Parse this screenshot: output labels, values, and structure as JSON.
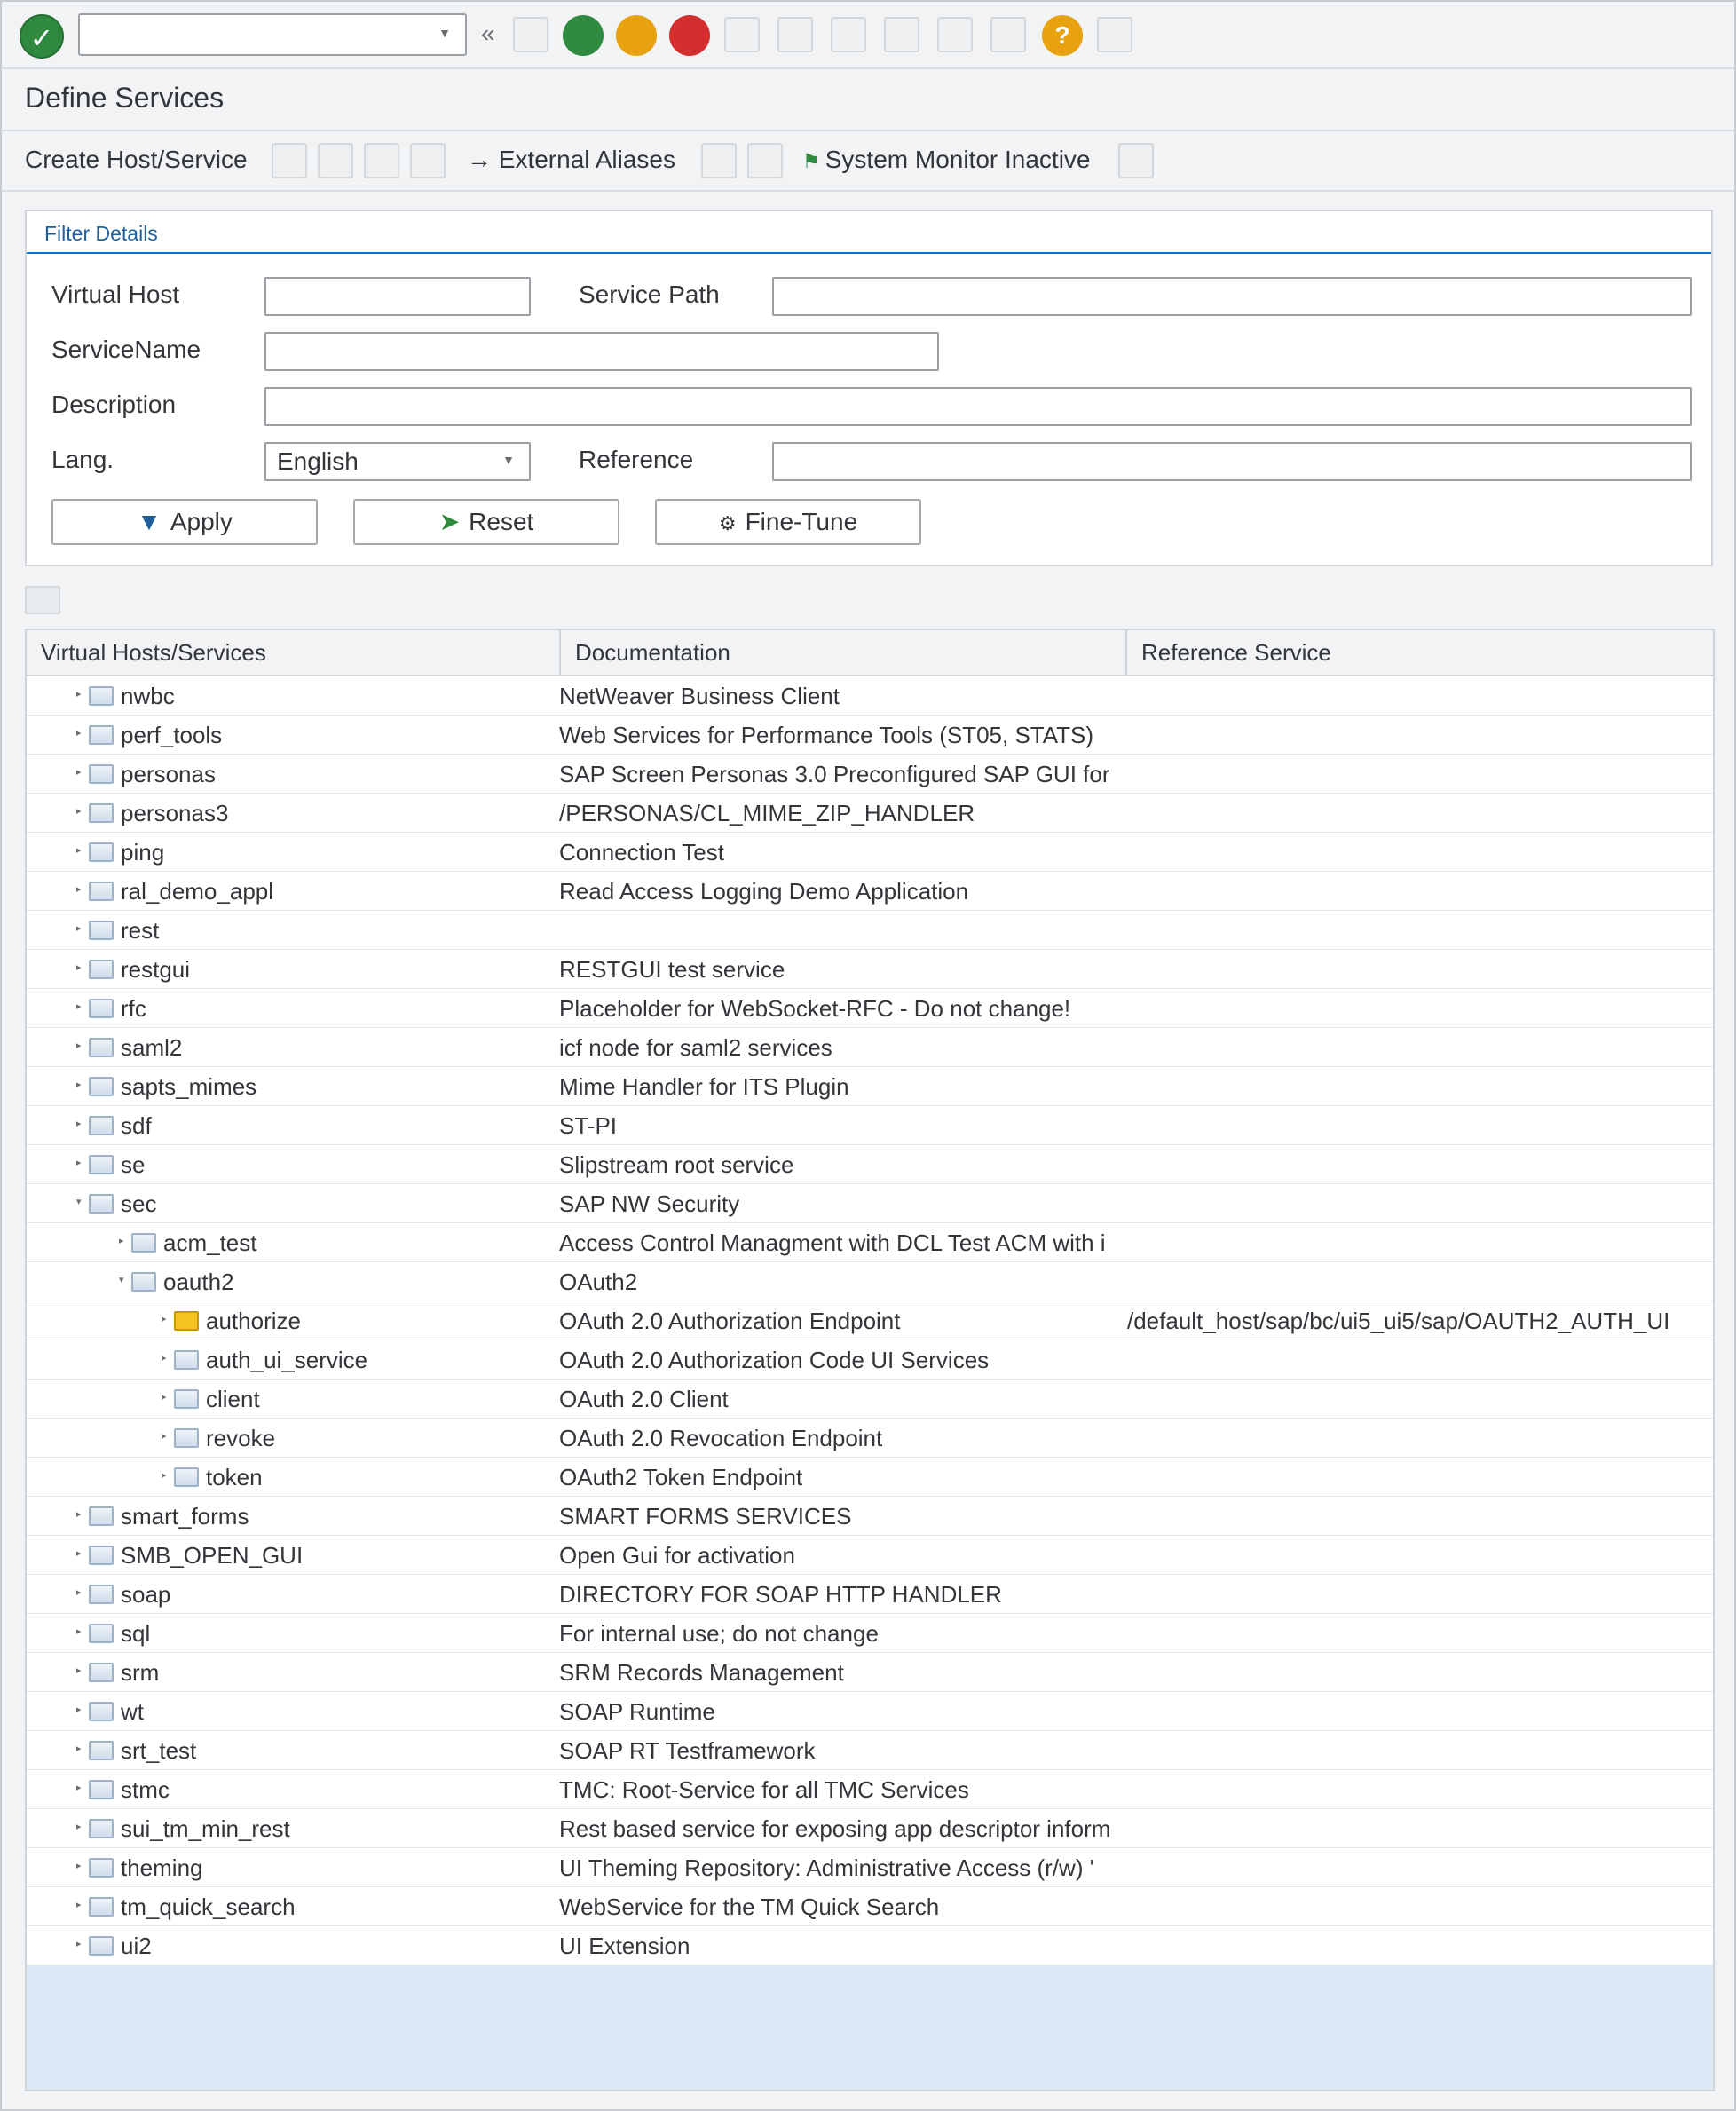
{
  "toolbar": {
    "command_field_value": "",
    "collapse_glyph": "«",
    "ok_glyph": "✓",
    "help_glyph": "?",
    "colors": {
      "green": "#2f8a3f",
      "orange": "#e8a20f",
      "red": "#d32f2f"
    }
  },
  "page": {
    "title": "Define Services"
  },
  "app_toolbar": {
    "create_host_service": "Create Host/Service",
    "external_aliases": "External Aliases",
    "external_aliases_icon": "→",
    "system_monitor": "System Monitor Inactive",
    "system_monitor_icon": "flag-icon"
  },
  "filter": {
    "header": "Filter Details",
    "virtual_host_label": "Virtual Host",
    "virtual_host_value": "",
    "service_path_label": "Service Path",
    "service_path_value": "",
    "service_name_label": "ServiceName",
    "service_name_value": "",
    "description_label": "Description",
    "description_value": "",
    "lang_label": "Lang.",
    "lang_value": "English",
    "reference_label": "Reference",
    "reference_value": "",
    "apply_label": "Apply",
    "reset_label": "Reset",
    "finetune_label": "Fine-Tune"
  },
  "table": {
    "columns": [
      "Virtual Hosts/Services",
      "Documentation",
      "Reference Service"
    ],
    "rows": [
      {
        "level": 0,
        "expanded": false,
        "name": "nwbc",
        "doc": "NetWeaver Business Client",
        "ref": ""
      },
      {
        "level": 0,
        "expanded": false,
        "name": "perf_tools",
        "doc": "Web Services for Performance Tools (ST05, STATS)",
        "ref": ""
      },
      {
        "level": 0,
        "expanded": false,
        "name": "personas",
        "doc": "SAP Screen Personas 3.0 Preconfigured SAP GUI for",
        "ref": ""
      },
      {
        "level": 0,
        "expanded": false,
        "name": "personas3",
        "doc": "/PERSONAS/CL_MIME_ZIP_HANDLER",
        "ref": ""
      },
      {
        "level": 0,
        "expanded": false,
        "name": "ping",
        "doc": "Connection Test",
        "ref": ""
      },
      {
        "level": 0,
        "expanded": false,
        "name": "ral_demo_appl",
        "doc": "Read Access Logging Demo Application",
        "ref": ""
      },
      {
        "level": 0,
        "expanded": false,
        "name": "rest",
        "doc": "",
        "ref": ""
      },
      {
        "level": 0,
        "expanded": false,
        "name": "restgui",
        "doc": "RESTGUI test service",
        "ref": ""
      },
      {
        "level": 0,
        "expanded": false,
        "name": "rfc",
        "doc": "Placeholder for WebSocket-RFC - Do not change!",
        "ref": ""
      },
      {
        "level": 0,
        "expanded": false,
        "name": "saml2",
        "doc": "icf node for saml2 services",
        "ref": ""
      },
      {
        "level": 0,
        "expanded": false,
        "name": "sapts_mimes",
        "doc": "Mime Handler for ITS Plugin",
        "ref": ""
      },
      {
        "level": 0,
        "expanded": false,
        "name": "sdf",
        "doc": "ST-PI",
        "ref": ""
      },
      {
        "level": 0,
        "expanded": false,
        "name": "se",
        "doc": "Slipstream root service",
        "ref": ""
      },
      {
        "level": 0,
        "expanded": true,
        "name": "sec",
        "doc": "SAP NW Security",
        "ref": ""
      },
      {
        "level": 1,
        "expanded": false,
        "name": "acm_test",
        "doc": "Access Control Managment with DCL Test ACM with i",
        "ref": ""
      },
      {
        "level": 1,
        "expanded": true,
        "name": "oauth2",
        "doc": "OAuth2",
        "ref": ""
      },
      {
        "level": 2,
        "expanded": false,
        "name": "authorize",
        "doc": "OAuth 2.0 Authorization Endpoint",
        "ref": "/default_host/sap/bc/ui5_ui5/sap/OAUTH2_AUTH_UI",
        "highlight": true
      },
      {
        "level": 2,
        "expanded": false,
        "name": "auth_ui_service",
        "doc": "OAuth 2.0 Authorization Code UI Services",
        "ref": ""
      },
      {
        "level": 2,
        "expanded": false,
        "name": "client",
        "doc": "OAuth 2.0 Client",
        "ref": ""
      },
      {
        "level": 2,
        "expanded": false,
        "name": "revoke",
        "doc": "OAuth 2.0 Revocation Endpoint",
        "ref": ""
      },
      {
        "level": 2,
        "expanded": false,
        "name": "token",
        "doc": "OAuth2 Token Endpoint",
        "ref": ""
      },
      {
        "level": 0,
        "expanded": false,
        "name": "smart_forms",
        "doc": "SMART FORMS SERVICES",
        "ref": ""
      },
      {
        "level": 0,
        "expanded": false,
        "name": "SMB_OPEN_GUI",
        "doc": "Open Gui for activation",
        "ref": ""
      },
      {
        "level": 0,
        "expanded": false,
        "name": "soap",
        "doc": "DIRECTORY FOR SOAP HTTP HANDLER",
        "ref": ""
      },
      {
        "level": 0,
        "expanded": false,
        "name": "sql",
        "doc": "For internal use; do not change",
        "ref": ""
      },
      {
        "level": 0,
        "expanded": false,
        "name": "srm",
        "doc": "SRM Records Management",
        "ref": ""
      },
      {
        "level": 0,
        "expanded": false,
        "name": "wt",
        "doc": "SOAP Runtime",
        "ref": ""
      },
      {
        "level": 0,
        "expanded": false,
        "name": "srt_test",
        "doc": "SOAP RT Testframework",
        "ref": ""
      },
      {
        "level": 0,
        "expanded": false,
        "name": "stmc",
        "doc": "TMC: Root-Service for all TMC Services",
        "ref": ""
      },
      {
        "level": 0,
        "expanded": false,
        "name": "sui_tm_min_rest",
        "doc": "Rest based service for exposing app descriptor inform",
        "ref": ""
      },
      {
        "level": 0,
        "expanded": false,
        "name": "theming",
        "doc": "UI Theming Repository: Administrative Access (r/w) '",
        "ref": ""
      },
      {
        "level": 0,
        "expanded": false,
        "name": "tm_quick_search",
        "doc": "WebService for the TM Quick Search",
        "ref": ""
      },
      {
        "level": 0,
        "expanded": false,
        "name": "ui2",
        "doc": "UI Extension",
        "ref": ""
      }
    ]
  }
}
